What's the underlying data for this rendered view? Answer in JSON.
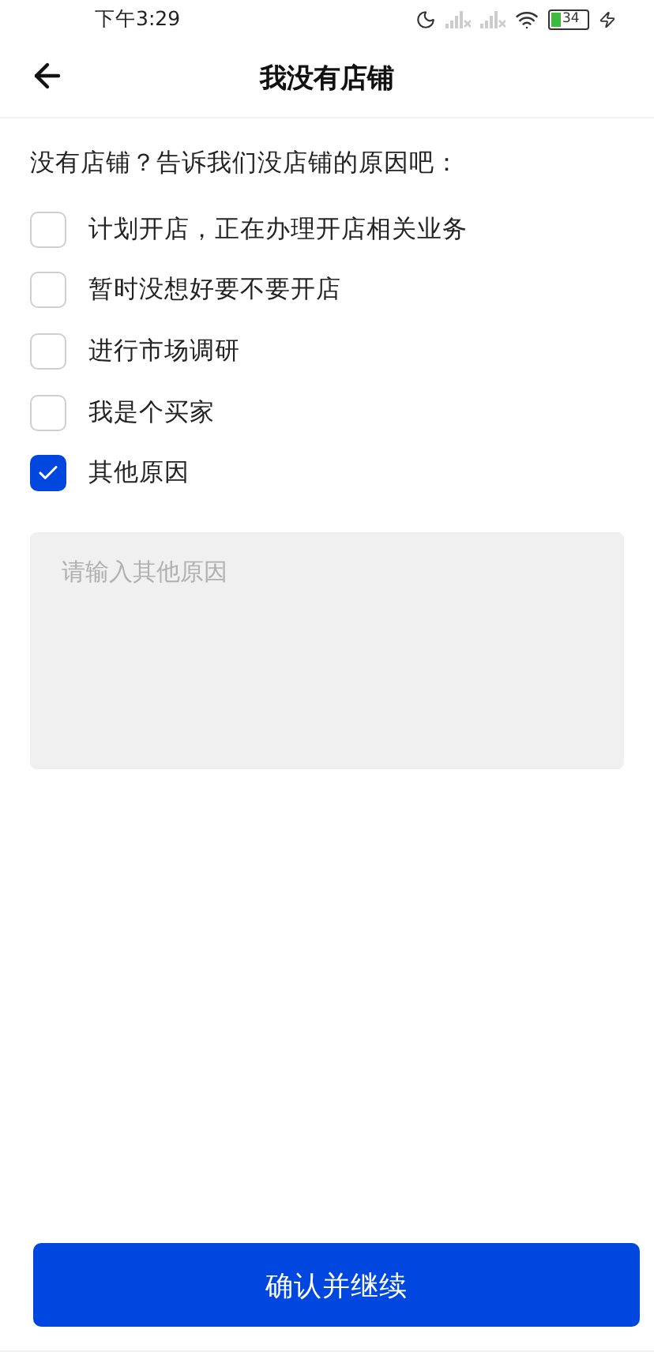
{
  "status_bar": {
    "time": "下午3:29",
    "battery": "34"
  },
  "header": {
    "title": "我没有店铺"
  },
  "prompt": "没有店铺？告诉我们没店铺的原因吧：",
  "options": [
    {
      "label": "计划开店，正在办理开店相关业务",
      "checked": false
    },
    {
      "label": "暂时没想好要不要开店",
      "checked": false
    },
    {
      "label": "进行市场调研",
      "checked": false
    },
    {
      "label": "我是个买家",
      "checked": false
    },
    {
      "label": "其他原因",
      "checked": true
    }
  ],
  "other_reason": {
    "placeholder": "请输入其他原因"
  },
  "confirm_button": "确认并继续"
}
